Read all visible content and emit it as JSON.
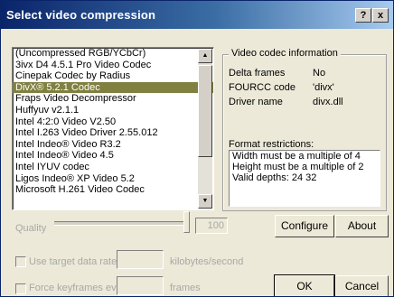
{
  "window": {
    "title": "Select video compression",
    "help_button": "?",
    "close_button": "x"
  },
  "codec_list": {
    "items": [
      "(Uncompressed RGB/YCbCr)",
      "3ivx D4 4.5.1 Pro Video Codec",
      "Cinepak Codec by Radius",
      "DivX® 5.2.1 Codec",
      "Fraps Video Decompressor",
      "Huffyuv v2.1.1",
      "Intel 4:2:0 Video V2.50",
      "Intel I.263 Video Driver 2.55.012",
      "Intel Indeo® Video R3.2",
      "Intel Indeo® Video 4.5",
      "Intel IYUV codec",
      "Ligos Indeo® XP Video 5.2",
      "Microsoft H.261 Video Codec"
    ],
    "selected": "DivX® 5.2.1 Codec"
  },
  "codec_info": {
    "group_title": "Video codec information",
    "delta_frames_label": "Delta frames",
    "delta_frames_value": "No",
    "fourcc_label": "FOURCC code",
    "fourcc_value": "'divx'",
    "driver_label": "Driver name",
    "driver_value": "divx.dll",
    "restrictions_label": "Format restrictions:",
    "restrictions": [
      "Width must be a multiple of 4",
      "Height must be a multiple of 2",
      "Valid depths: 24 32"
    ]
  },
  "quality": {
    "label": "Quality",
    "value": "100"
  },
  "buttons": {
    "configure": "Configure",
    "about": "About",
    "ok": "OK",
    "cancel": "Cancel"
  },
  "options": {
    "target_rate_label": "Use target data rate of",
    "target_rate_unit": "kilobytes/second",
    "keyframes_label": "Force keyframes every",
    "keyframes_unit": "frames"
  }
}
